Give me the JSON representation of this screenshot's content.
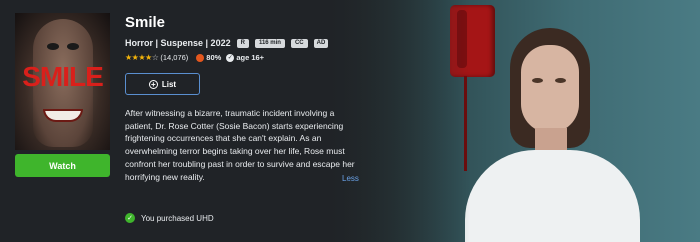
{
  "movie": {
    "title": "Smile",
    "genres": "Horror | Suspense | 2022",
    "tags": [
      "R",
      "116 min",
      "CC",
      "AD"
    ],
    "stars": "★★★★",
    "stars_empty": "☆",
    "rating_count": "(14,076)",
    "critic_score": "80%",
    "age": "age 16+",
    "description": "After witnessing a bizarre, traumatic incident involving a patient, Dr. Rose Cotter (Sosie Bacon) starts experiencing frightening occurrences that she can't explain. As an overwhelming terror begins taking over her life, Rose must confront her troubling past in order to survive and escape her horrifying new reality.",
    "less_label": "Less",
    "purchased_label": "You purchased UHD",
    "poster_title": "SMILE"
  },
  "buttons": {
    "watch_label": "Watch",
    "list_label": "List"
  },
  "icons": {
    "plus": "+",
    "check": "✓",
    "badge_check": "✓"
  },
  "colors": {
    "watch": "#3fb52c",
    "link": "#6aa2e8",
    "star": "#f5b50a"
  }
}
